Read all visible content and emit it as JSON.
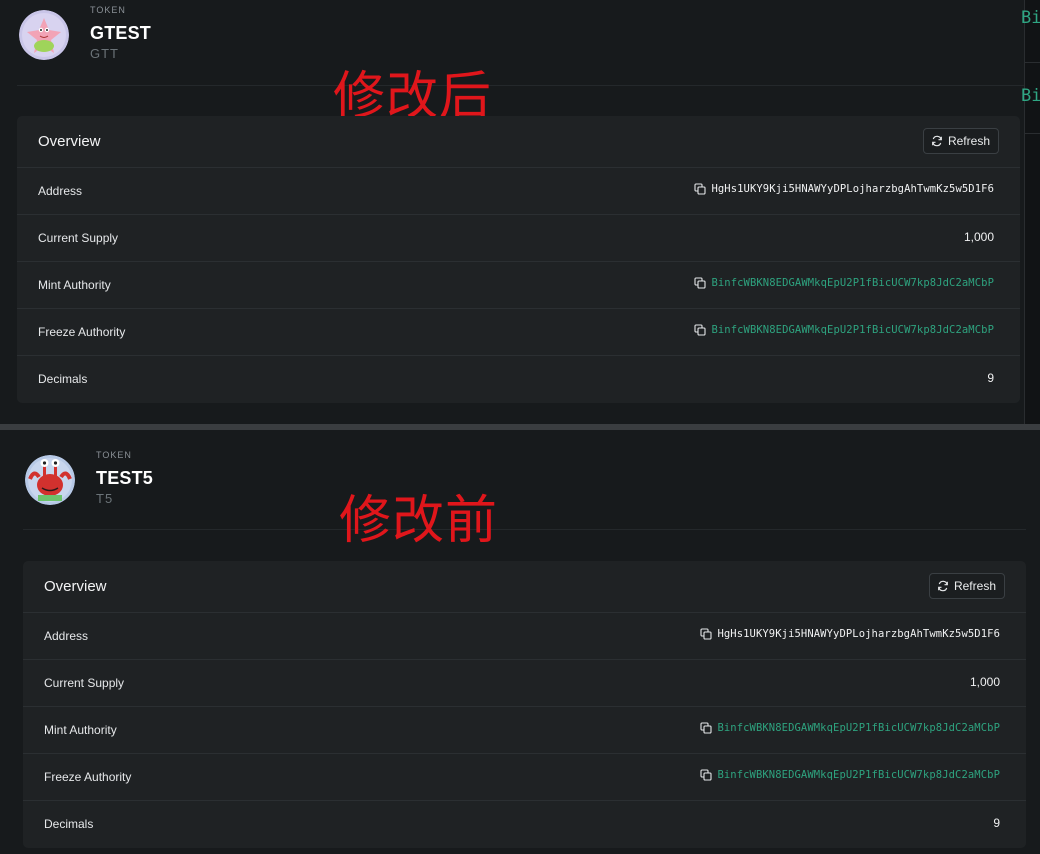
{
  "panels": [
    {
      "annotation": "修改后",
      "token_kicker": "TOKEN",
      "token_name": "GTEST",
      "token_symbol": "GTT",
      "avatar_icon": "patrick-star-avatar",
      "overview": {
        "title": "Overview",
        "refresh_label": "Refresh",
        "rows": [
          {
            "label": "Address",
            "value": "HgHs1UKY9Kji5HNAWYyDPLojharzbgAhTwmKz5w5D1F6",
            "copy": true,
            "link": false
          },
          {
            "label": "Current Supply",
            "value": "1,000",
            "copy": false,
            "link": false
          },
          {
            "label": "Mint Authority",
            "value": "BinfcWBKN8EDGAWMkqEpU2P1fBicUCW7kp8JdC2aMCbP",
            "copy": true,
            "link": true
          },
          {
            "label": "Freeze Authority",
            "value": "BinfcWBKN8EDGAWMkqEpU2P1fBicUCW7kp8JdC2aMCbP",
            "copy": true,
            "link": true
          },
          {
            "label": "Decimals",
            "value": "9",
            "copy": false,
            "link": false
          }
        ]
      }
    },
    {
      "annotation": "修改前",
      "token_kicker": "TOKEN",
      "token_name": "TEST5",
      "token_symbol": "T5",
      "avatar_icon": "mr-krabs-avatar",
      "overview": {
        "title": "Overview",
        "refresh_label": "Refresh",
        "rows": [
          {
            "label": "Address",
            "value": "HgHs1UKY9Kji5HNAWYyDPLojharzbgAhTwmKz5w5D1F6",
            "copy": true,
            "link": false
          },
          {
            "label": "Current Supply",
            "value": "1,000",
            "copy": false,
            "link": false
          },
          {
            "label": "Mint Authority",
            "value": "BinfcWBKN8EDGAWMkqEpU2P1fBicUCW7kp8JdC2aMCbP",
            "copy": true,
            "link": true
          },
          {
            "label": "Freeze Authority",
            "value": "BinfcWBKN8EDGAWMkqEpU2P1fBicUCW7kp8JdC2aMCbP",
            "copy": true,
            "link": true
          },
          {
            "label": "Decimals",
            "value": "9",
            "copy": false,
            "link": false
          }
        ]
      }
    }
  ],
  "edge_fragments": [
    "Bi",
    "Bi"
  ],
  "colors": {
    "background": "#171a1c",
    "card": "#1f2224",
    "link": "#2ea37f",
    "annotation": "#e0161b"
  }
}
